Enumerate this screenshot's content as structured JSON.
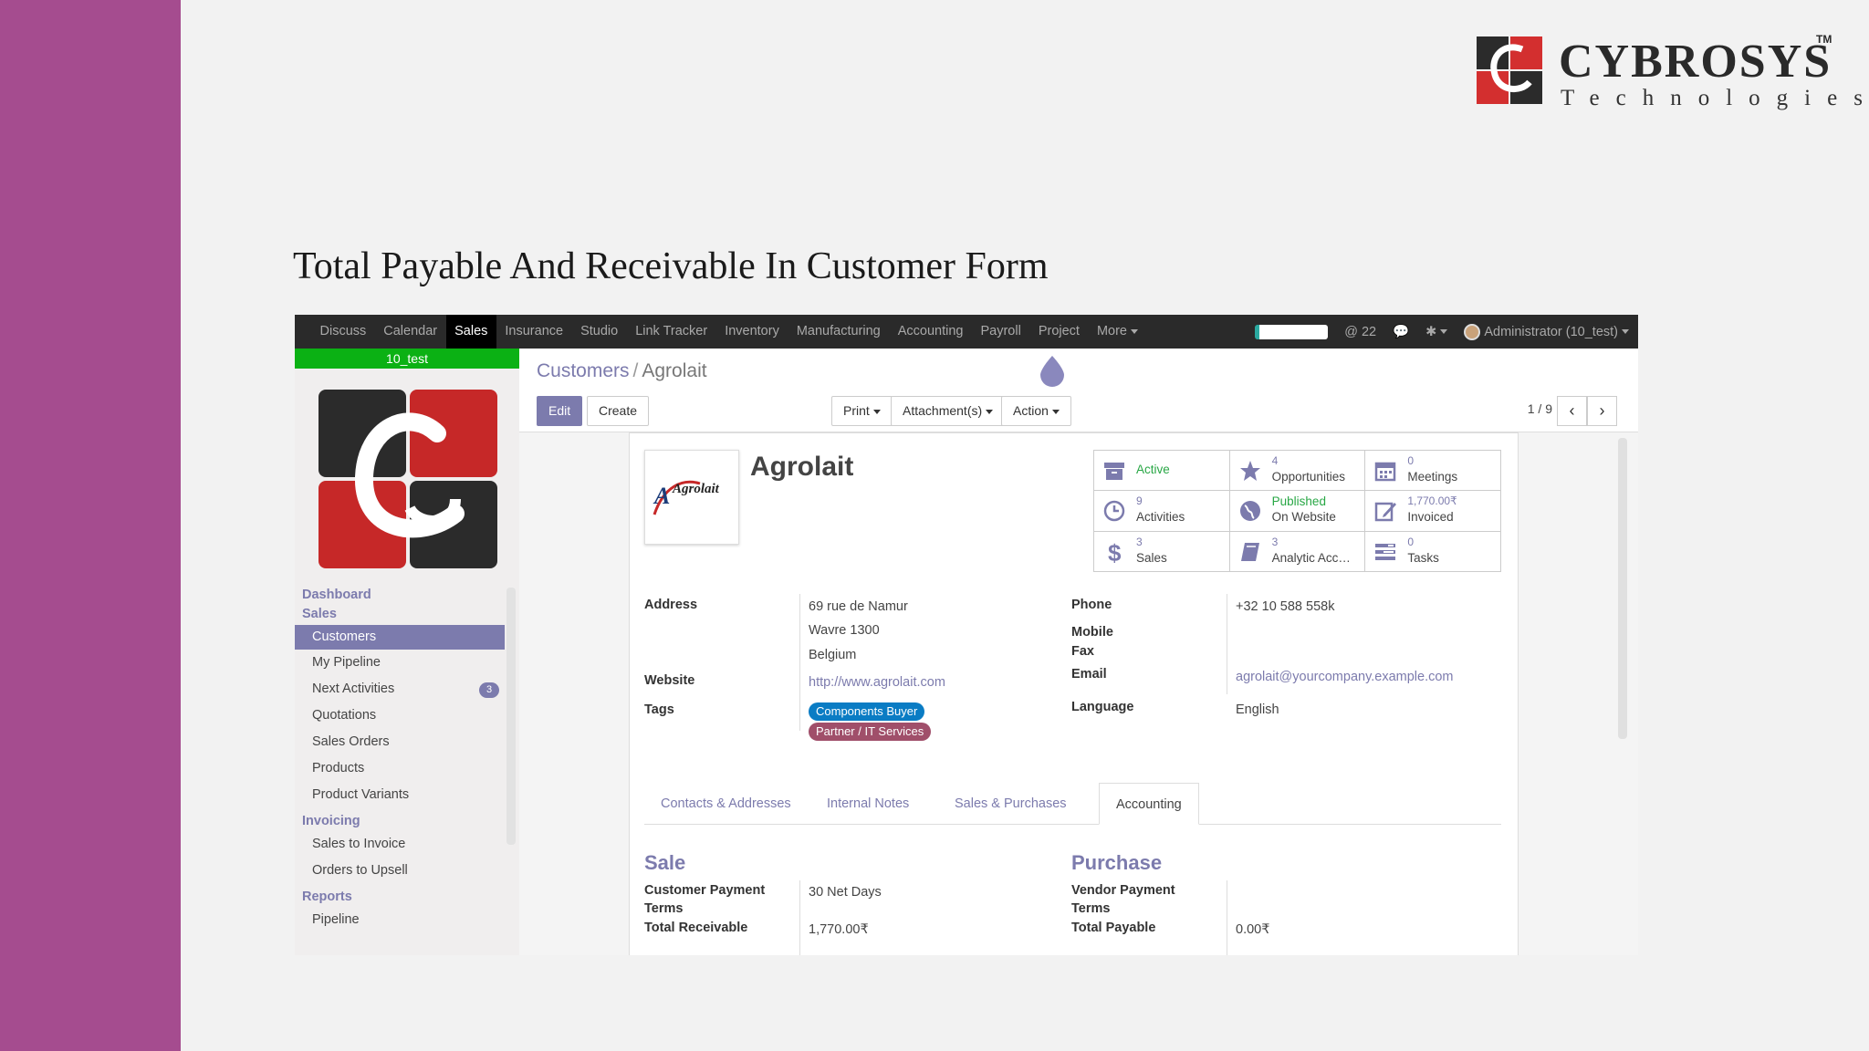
{
  "brand": {
    "name": "CYBROSYS",
    "tm": "TM",
    "sub": "Technologies",
    "colors": {
      "red": "#d32f2f",
      "dark": "#2b2b2b"
    }
  },
  "slide_title": "Total Payable And Receivable In Customer Form",
  "topbar": {
    "menu": [
      "Discuss",
      "Calendar",
      "Sales",
      "Insurance",
      "Studio",
      "Link Tracker",
      "Inventory",
      "Manufacturing",
      "Accounting",
      "Payroll",
      "Project",
      "More"
    ],
    "active_menu": "Sales",
    "mentions": "22",
    "user": "Administrator (10_test)"
  },
  "sidebar": {
    "db_name": "10_test",
    "groups": [
      {
        "label": "Dashboard"
      },
      {
        "label": "Sales"
      }
    ],
    "sales_items": [
      {
        "label": "Customers",
        "selected": true
      },
      {
        "label": "My Pipeline"
      },
      {
        "label": "Next Activities",
        "badge": "3"
      },
      {
        "label": "Quotations"
      },
      {
        "label": "Sales Orders"
      },
      {
        "label": "Products"
      },
      {
        "label": "Product Variants"
      }
    ],
    "invoicing_label": "Invoicing",
    "invoicing_items": [
      "Sales to Invoice",
      "Orders to Upsell"
    ],
    "reports_label": "Reports",
    "reports_items": [
      "Pipeline"
    ]
  },
  "control_panel": {
    "breadcrumb_parent": "Customers",
    "breadcrumb_sep": "/",
    "breadcrumb_current": "Agrolait",
    "edit": "Edit",
    "create": "Create",
    "print": "Print",
    "attachments": "Attachment(s)",
    "action": "Action",
    "pager": "1 / 9"
  },
  "record": {
    "name": "Agrolait",
    "logo_text": "Agrolait",
    "stats": [
      {
        "icon": "archive-icon",
        "num": "",
        "label": "Active",
        "style": "single"
      },
      {
        "icon": "star-icon",
        "num": "4",
        "label": "Opportunities"
      },
      {
        "icon": "calendar-icon",
        "num": "0",
        "label": "Meetings"
      },
      {
        "icon": "clock-icon",
        "num": "9",
        "label": "Activities"
      },
      {
        "icon": "globe-icon",
        "num": "Published",
        "label": "On Website",
        "style": "green"
      },
      {
        "icon": "edit-icon",
        "num": "1,770.00₹",
        "label": "Invoiced"
      },
      {
        "icon": "dollar-icon",
        "num": "3",
        "label": "Sales"
      },
      {
        "icon": "book-icon",
        "num": "3",
        "label": "Analytic Acc…"
      },
      {
        "icon": "tasks-icon",
        "num": "0",
        "label": "Tasks"
      }
    ],
    "labels": {
      "address": "Address",
      "website": "Website",
      "tags": "Tags",
      "phone": "Phone",
      "mobile": "Mobile",
      "fax": "Fax",
      "email": "Email",
      "language": "Language"
    },
    "address": [
      "69 rue de Namur",
      "Wavre 1300",
      "Belgium"
    ],
    "website": "http://www.agrolait.com",
    "tags": [
      {
        "label": "Components Buyer",
        "color": "#0a7cc4"
      },
      {
        "label": "Partner / IT Services",
        "color": "#a04f6a"
      }
    ],
    "phone": "+32 10 588 558k",
    "email": "agrolait@yourcompany.example.com",
    "language": "English"
  },
  "tabs": [
    {
      "label": "Contacts & Addresses"
    },
    {
      "label": "Internal Notes"
    },
    {
      "label": "Sales & Purchases"
    },
    {
      "label": "Accounting",
      "active": true
    }
  ],
  "accounting": {
    "sale_title": "Sale",
    "purchase_title": "Purchase",
    "customer_payment_terms_label_1": "Customer Payment",
    "customer_payment_terms_label_2": "Terms",
    "customer_payment_terms": "30 Net Days",
    "total_receivable_label": "Total Receivable",
    "total_receivable": "1,770.00₹",
    "vendor_payment_terms_label_1": "Vendor Payment",
    "vendor_payment_terms_label_2": "Terms",
    "total_payable_label": "Total Payable",
    "total_payable": "0.00₹"
  }
}
